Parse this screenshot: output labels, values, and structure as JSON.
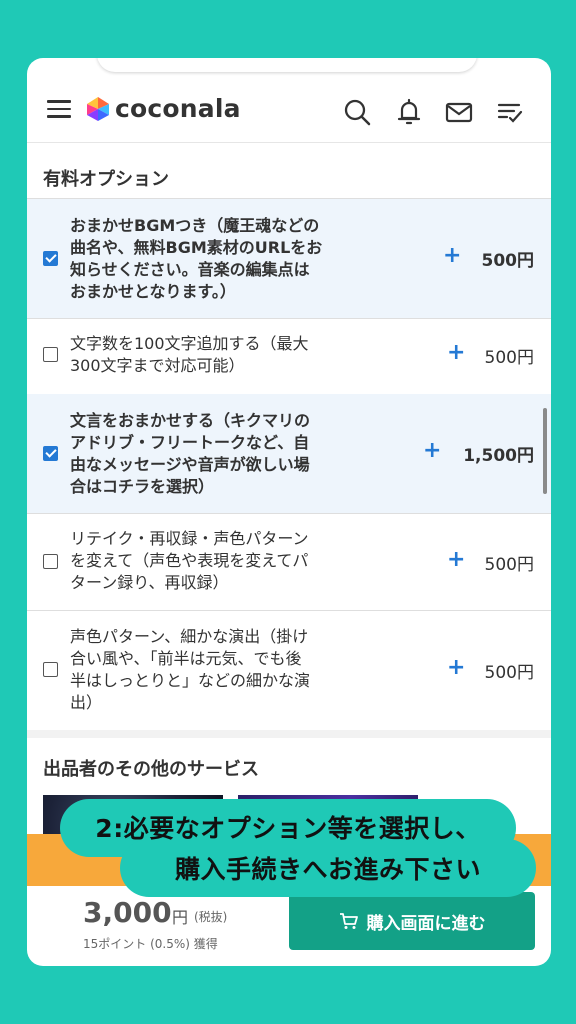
{
  "header": {
    "logo": "coconala"
  },
  "paid_options": {
    "title": "有料オプション",
    "items": [
      {
        "checked": true,
        "lines": [
          "おまかせBGMつき（魔王魂などの",
          "曲名や、無料BGM素材のURLをお",
          "知らせください。音楽の編集点は",
          "おまかせとなります。）"
        ],
        "plus": "+",
        "price": "500円"
      },
      {
        "checked": false,
        "lines": [
          "文字数を100文字追加する（最大",
          "300文字まで対応可能）"
        ],
        "plus": "+",
        "price": "500円"
      },
      {
        "checked": true,
        "lines": [
          "文言をおまかせする（キクマリの",
          "アドリブ・フリートークなど、自",
          "由なメッセージや音声が欲しい場",
          "合はコチラを選択）"
        ],
        "plus": "+",
        "price": "1,500円"
      },
      {
        "checked": false,
        "lines": [
          "リテイク・再収録・声色パターン",
          "を変えて（声色や表現を変えてパ",
          "ターン録り、再収録）"
        ],
        "plus": "+",
        "price": "500円"
      },
      {
        "checked": false,
        "lines": [
          "声色パターン、細かな演出（掛け",
          "合い風や、「前半は元気、でも後",
          "半はしっとりと」などの細かな演",
          "出）"
        ],
        "plus": "+",
        "price": "500円"
      }
    ]
  },
  "other_services": {
    "title": "出品者のその他のサービス"
  },
  "purchase": {
    "price": "3,000",
    "yen": "円",
    "tax": "(税抜)",
    "points": "15ポイント (0.5%) 獲得",
    "button_label": "購入画面に進む"
  },
  "callout": {
    "line1": "2:必要なオプション等を選択し、",
    "line2": "購入手続きへお進み下さい"
  },
  "colors": {
    "background": "#1fc9b6",
    "accent_blue": "#2479d4",
    "buy_button": "#13a187",
    "banner_orange": "#f7a83b"
  }
}
